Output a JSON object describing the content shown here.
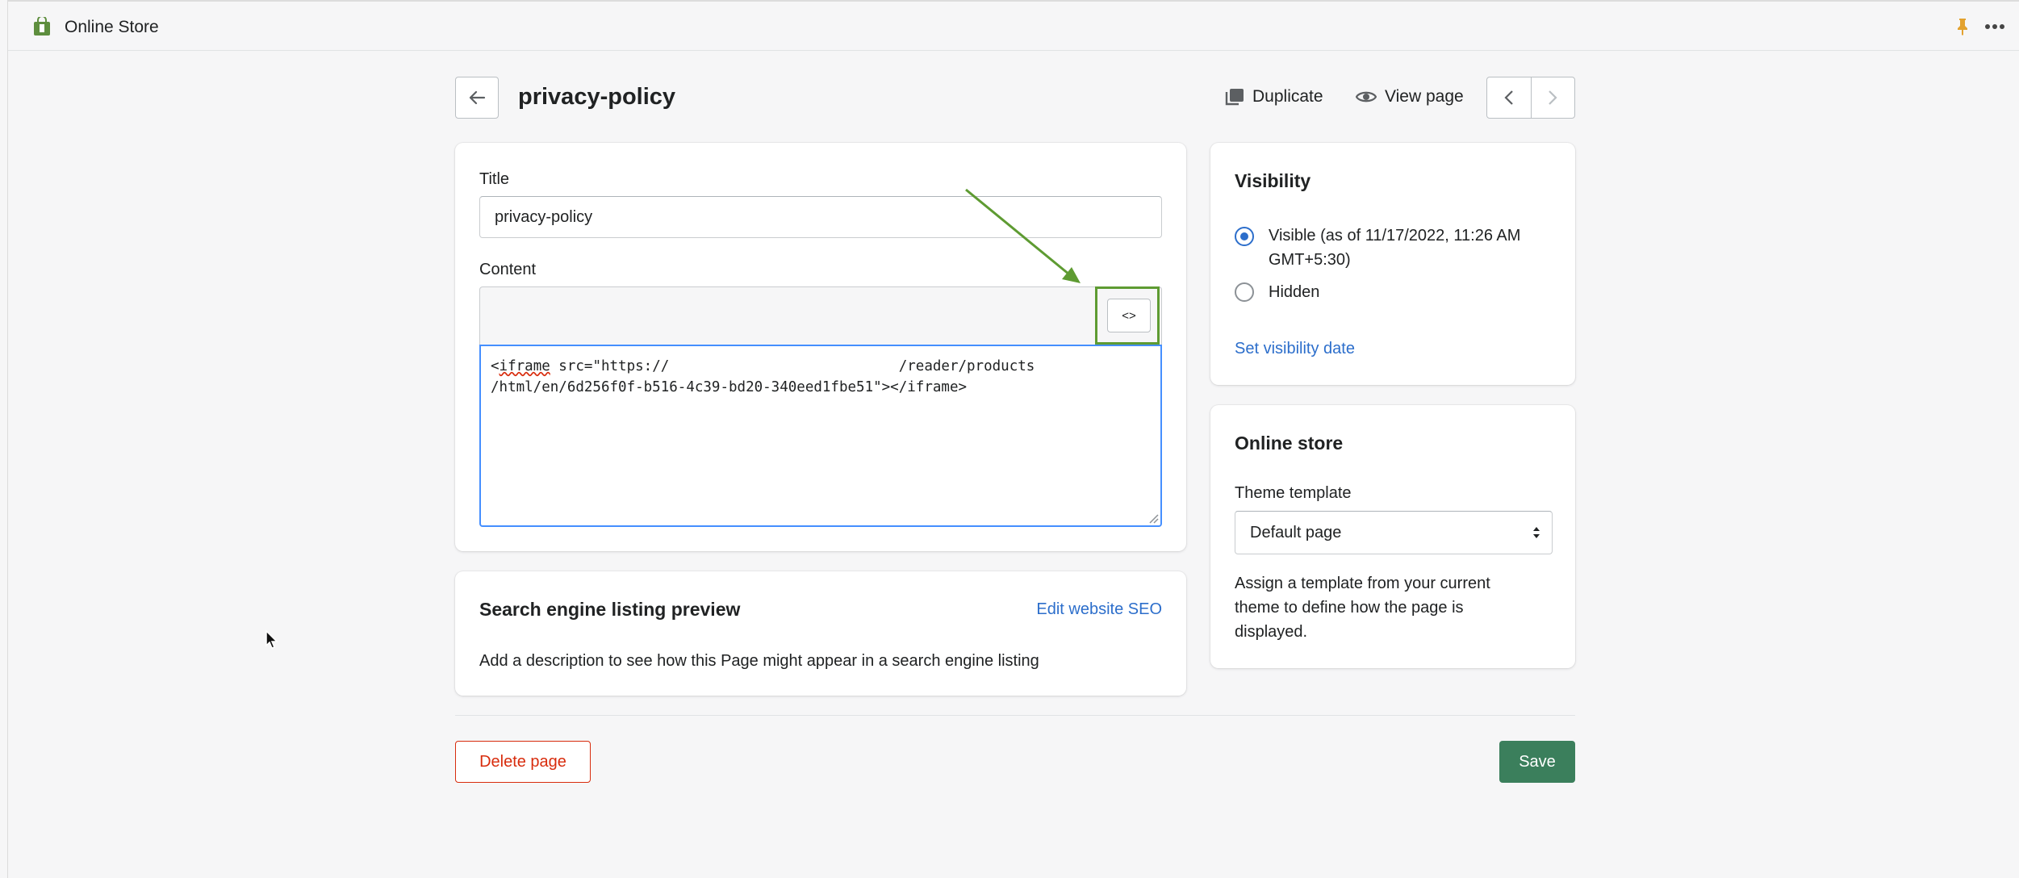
{
  "app": {
    "title": "Online Store",
    "icon": "shopify-bag-icon"
  },
  "header": {
    "page_title": "privacy-policy",
    "duplicate_label": "Duplicate",
    "view_page_label": "View page"
  },
  "editor": {
    "title_label": "Title",
    "title_value": "privacy-policy",
    "content_label": "Content",
    "html_toggle_label": "<>",
    "code_line1_a": "<",
    "code_line1_b": "iframe",
    "code_line1_c": " src=\"https://                           /reader/products",
    "code_line2": "/html/en/6d256f0f-b516-4c39-bd20-340eed1fbe51\"></iframe>"
  },
  "seo": {
    "heading": "Search engine listing preview",
    "edit_link": "Edit website SEO",
    "description": "Add a description to see how this Page might appear in a search engine listing"
  },
  "visibility": {
    "heading": "Visibility",
    "visible_label_line1": "Visible (as of 11/17/2022, 11:26 AM",
    "visible_label_line2": "GMT+5:30)",
    "hidden_label": "Hidden",
    "selected": "visible",
    "set_date_link": "Set visibility date"
  },
  "online_store": {
    "heading": "Online store",
    "theme_template_label": "Theme template",
    "theme_template_value": "Default page",
    "help_line1": "Assign a template from your current",
    "help_line2": "theme to define how the page is",
    "help_line3": "displayed."
  },
  "footer": {
    "delete_label": "Delete page",
    "save_label": "Save"
  },
  "colors": {
    "save": "#3b7f5c",
    "delete": "#d82c0d",
    "link": "#2c6ecb",
    "annotation": "#5e9b32",
    "focus": "#458fff"
  }
}
